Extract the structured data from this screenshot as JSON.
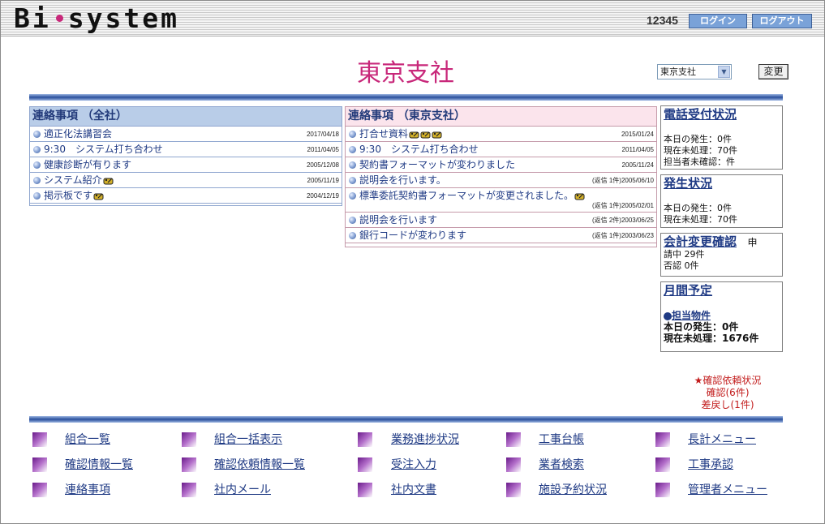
{
  "header": {
    "logo_left": "Bi",
    "logo_right": "system",
    "user_id": "12345",
    "login_label": "ログイン",
    "logout_label": "ログアウト"
  },
  "office": {
    "title": "東京支社",
    "selected_branch": "東京支社",
    "change_label": "変更"
  },
  "notices_all": {
    "heading": "連絡事項 （全社）",
    "items": [
      {
        "title": "適正化法講習会",
        "date": "2017/04/18",
        "new": 0
      },
      {
        "title": "9:30　システム打ち合わせ",
        "date": "2011/04/05",
        "new": 0
      },
      {
        "title": "健康診断が有ります",
        "date": "2005/12/08",
        "new": 0
      },
      {
        "title": "システム紹介",
        "date": "2005/11/19",
        "new": 1
      },
      {
        "title": "掲示板です",
        "date": "2004/12/19",
        "new": 1
      }
    ]
  },
  "notices_branch": {
    "heading": "連絡事項 （東京支社）",
    "items": [
      {
        "title": "打合せ資料",
        "date": "2015/01/24",
        "new": 3
      },
      {
        "title": "9:30　システム打ち合わせ",
        "date": "2011/04/05",
        "new": 0
      },
      {
        "title": "契約書フォーマットが変わりました",
        "date": "2005/11/24",
        "new": 0
      },
      {
        "title": "説明会を行います。",
        "date": "(返信 1件)2005/06/10",
        "new": 0
      },
      {
        "title": "標準委託契約書フォーマットが変更されました。",
        "date": "(返信 1件)2005/02/01",
        "new": 1
      },
      {
        "title": "説明会を行います",
        "date": "(返信 2件)2003/06/25",
        "new": 0
      },
      {
        "title": "銀行コードが変わります",
        "date": "(返信 1件)2003/06/23",
        "new": 0
      }
    ]
  },
  "status": {
    "phone": {
      "title": "電話受付状況",
      "lines": [
        "本日の発生：0件",
        "現在未処理：70件",
        "担当者未確認：件"
      ]
    },
    "occurrence": {
      "title": "発生状況",
      "lines": [
        "本日の発生：0件",
        "現在未処理：70件"
      ]
    },
    "audit": {
      "title": "会計変更確認",
      "title_suffix": "申",
      "lines": [
        "請中 29件",
        "否認 0件"
      ]
    },
    "monthly": {
      "title": "月間予定",
      "subhead": "担当物件",
      "lines": [
        "本日の発生：0件",
        "現在未処理：1676件"
      ]
    }
  },
  "confirm": {
    "line1": "★確認依頼状況",
    "line2": "確認(6件)",
    "line3": "差戻し(1件)"
  },
  "menu": [
    [
      "組合一覧",
      "組合一括表示",
      "業務進捗状況",
      "工事台帳",
      "長計メニュー"
    ],
    [
      "確認情報一覧",
      "確認依頼情報一覧",
      "受注入力",
      "業者検索",
      "工事承認"
    ],
    [
      "連絡事項",
      "社内メール",
      "社内文書",
      "施設予約状況",
      "管理者メニュー"
    ]
  ]
}
